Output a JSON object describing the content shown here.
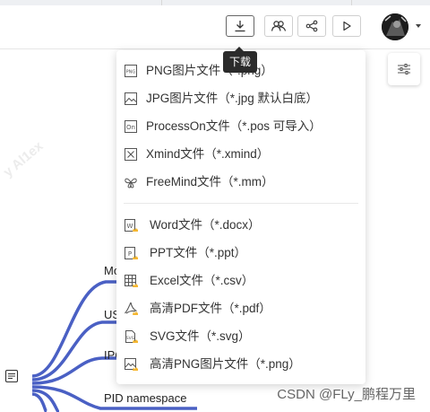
{
  "toolbar": {
    "download_tooltip": "下载",
    "buttons": [
      "download-icon",
      "collaborators-icon",
      "share-icon",
      "play-icon"
    ]
  },
  "download_menu": {
    "items": [
      {
        "label": "PNG图片文件（*.png）",
        "icon": "png-file-icon"
      },
      {
        "label": "JPG图片文件（*.jpg 默认白底）",
        "icon": "jpg-file-icon"
      },
      {
        "label": "ProcessOn文件（*.pos 可导入）",
        "icon": "processon-file-icon"
      },
      {
        "label": "Xmind文件（*.xmind）",
        "icon": "xmind-file-icon"
      },
      {
        "label": "FreeMind文件（*.mm）",
        "icon": "freemind-file-icon"
      }
    ],
    "pro_items": [
      {
        "label": "Word文件（*.docx）",
        "icon": "word-file-icon"
      },
      {
        "label": "PPT文件（*.ppt）",
        "icon": "ppt-file-icon"
      },
      {
        "label": "Excel文件（*.csv）",
        "icon": "excel-file-icon"
      },
      {
        "label": "高清PDF文件（*.pdf）",
        "icon": "pdf-file-icon"
      },
      {
        "label": "SVG文件（*.svg）",
        "icon": "svg-file-icon"
      },
      {
        "label": "高清PNG图片文件（*.png）",
        "icon": "hd-png-file-icon"
      }
    ]
  },
  "mindmap": {
    "nodes": [
      "Mo",
      "US",
      "IPC",
      "PID namespace"
    ]
  },
  "watermarks": [
    "y Al1ex"
  ],
  "footer": "CSDN @FLy_鹏程万里",
  "colors": {
    "branch": "#4a60c4",
    "crown": "#f5b731"
  }
}
